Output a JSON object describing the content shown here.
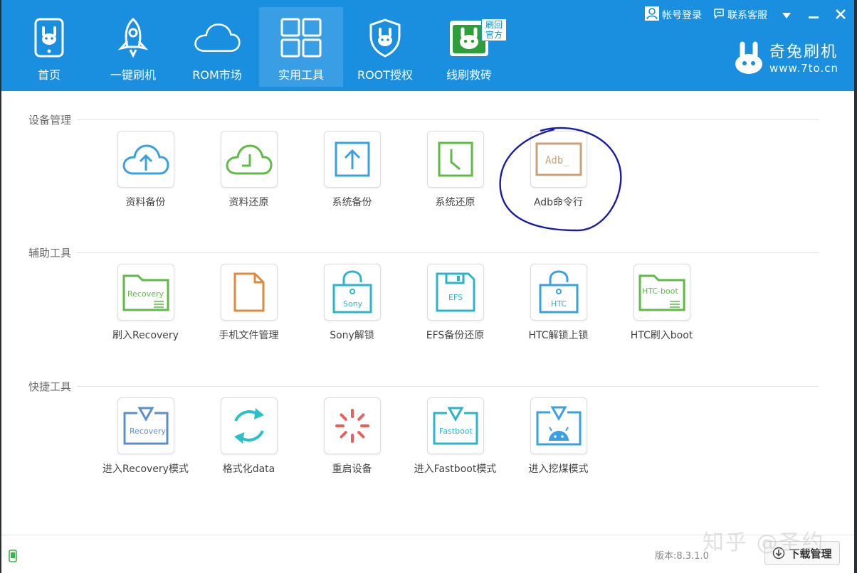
{
  "nav": {
    "items": [
      {
        "label": "首页",
        "icon": "phone-icon"
      },
      {
        "label": "一键刷机",
        "icon": "rocket-icon"
      },
      {
        "label": "ROM市场",
        "icon": "cloud-icon"
      },
      {
        "label": "实用工具",
        "icon": "grid-icon"
      },
      {
        "label": "ROOT授权",
        "icon": "shield-icon"
      },
      {
        "label": "线刷救砖",
        "icon": "rescue-icon",
        "badge": "刷回官方"
      }
    ],
    "active": "实用工具"
  },
  "top_actions": {
    "login": "帐号登录",
    "support": "联系客服"
  },
  "brand": {
    "name": "奇兔刷机",
    "url": "www.7to.cn"
  },
  "sections": [
    {
      "title": "设备管理",
      "tools": [
        {
          "label": "资料备份",
          "icon": "cloud-upload-icon"
        },
        {
          "label": "资料还原",
          "icon": "cloud-restore-icon"
        },
        {
          "label": "系统备份",
          "icon": "system-backup-icon"
        },
        {
          "label": "系统还原",
          "icon": "system-restore-icon"
        },
        {
          "label": "Adb命令行",
          "icon": "adb-terminal-icon",
          "icon_text": "Adb_"
        }
      ]
    },
    {
      "title": "辅助工具",
      "tools": [
        {
          "label": "刷入Recovery",
          "icon": "recovery-folder-icon",
          "icon_text": "Recovery"
        },
        {
          "label": "手机文件管理",
          "icon": "document-icon"
        },
        {
          "label": "Sony解锁",
          "icon": "sony-unlock-icon",
          "icon_text": "Sony"
        },
        {
          "label": "EFS备份还原",
          "icon": "efs-floppy-icon",
          "icon_text": "EFS"
        },
        {
          "label": "HTC解锁上锁",
          "icon": "htc-unlock-icon",
          "icon_text": "HTC"
        },
        {
          "label": "HTC刷入boot",
          "icon": "htc-boot-folder-icon",
          "icon_text": "HTC-boot"
        }
      ]
    },
    {
      "title": "快捷工具",
      "tools": [
        {
          "label": "进入Recovery模式",
          "icon": "recovery-mode-icon",
          "icon_text": "Recovery"
        },
        {
          "label": "格式化data",
          "icon": "format-refresh-icon"
        },
        {
          "label": "重启设备",
          "icon": "reboot-spinner-icon"
        },
        {
          "label": "进入Fastboot模式",
          "icon": "fastboot-mode-icon",
          "icon_text": "Fastboot"
        },
        {
          "label": "进入挖煤模式",
          "icon": "download-mode-icon"
        }
      ]
    }
  ],
  "status": {
    "version": "版本:8.3.1.0",
    "download_manager": "下载管理"
  },
  "watermark": "知乎 @圣约",
  "colors": {
    "header": "#1a8fe0",
    "annotation": "#1a1aa8"
  }
}
